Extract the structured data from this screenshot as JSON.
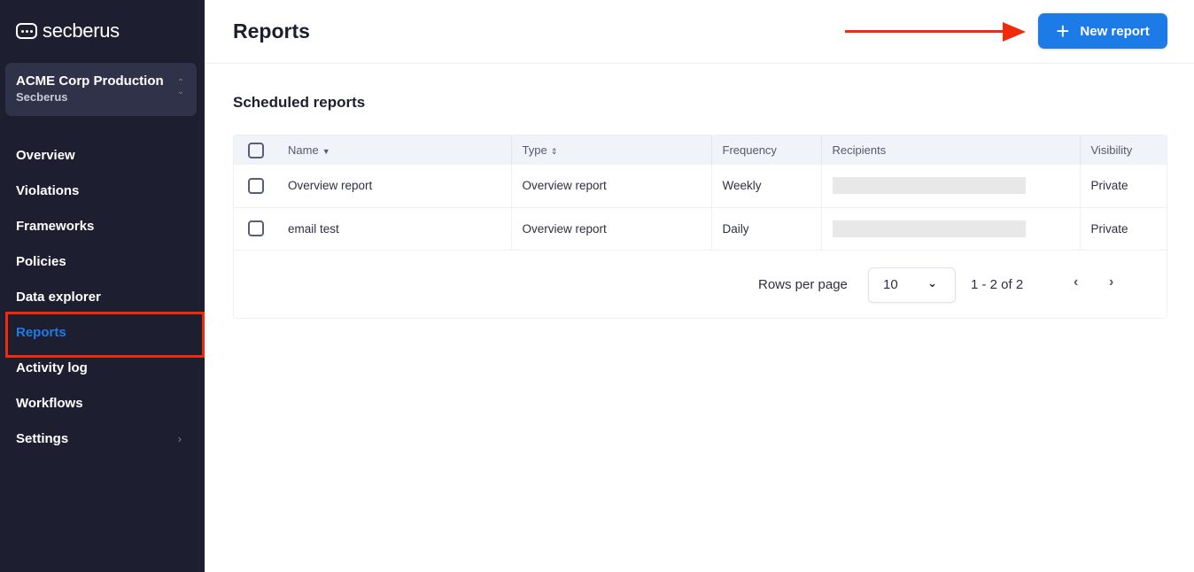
{
  "brand": {
    "name": "secberus"
  },
  "org": {
    "name": "ACME Corp Production",
    "sub": "Secberus"
  },
  "sidebar": {
    "items": [
      {
        "label": "Overview"
      },
      {
        "label": "Violations"
      },
      {
        "label": "Frameworks"
      },
      {
        "label": "Policies"
      },
      {
        "label": "Data explorer"
      },
      {
        "label": "Reports",
        "active": true
      },
      {
        "label": "Activity log"
      },
      {
        "label": "Workflows"
      },
      {
        "label": "Settings",
        "has_submenu": true
      }
    ]
  },
  "header": {
    "title": "Reports",
    "new_button": "New report"
  },
  "section": {
    "title": "Scheduled reports"
  },
  "table": {
    "columns": [
      "Name",
      "Type",
      "Frequency",
      "Recipients",
      "Visibility"
    ],
    "rows": [
      {
        "name": "Overview report",
        "type": "Overview report",
        "frequency": "Weekly",
        "recipients": "",
        "visibility": "Private"
      },
      {
        "name": "email test",
        "type": "Overview report",
        "frequency": "Daily",
        "recipients": "",
        "visibility": "Private"
      }
    ]
  },
  "pagination": {
    "rows_label": "Rows per page",
    "rows_value": "10",
    "range": "1 - 2 of 2"
  },
  "colors": {
    "accent": "#1d7be8",
    "sidebar_bg": "#1d1f31",
    "annotation": "#f02a0a"
  }
}
